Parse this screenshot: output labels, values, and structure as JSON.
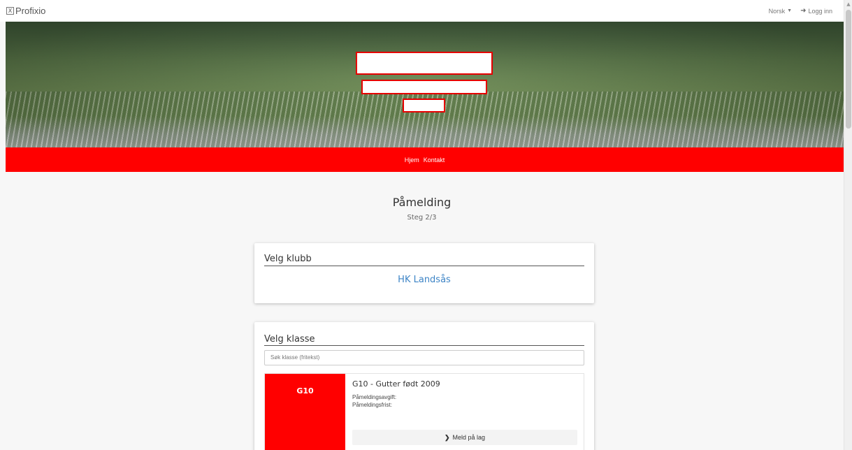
{
  "header": {
    "logo_mark": "X",
    "logo_text": "Profixio",
    "language": "Norsk",
    "login": "Logg inn"
  },
  "nav": {
    "items": [
      "Hjem",
      "Kontakt"
    ]
  },
  "page": {
    "title": "Påmelding",
    "step": "Steg 2/3"
  },
  "club_card": {
    "title": "Velg klubb",
    "club": "HK Landsås"
  },
  "class_card": {
    "title": "Velg klasse",
    "search_placeholder": "Søk klasse (fritekst)",
    "items": [
      {
        "badge": "G10",
        "name": "G10 - Gutter født 2009",
        "fee_label": "Påmeldingsavgift:",
        "deadline_label": "Påmeldingsfrist:",
        "button": "Meld på lag"
      }
    ]
  },
  "colors": {
    "brand_red": "#ff0000",
    "link_blue": "#3d84c6"
  }
}
